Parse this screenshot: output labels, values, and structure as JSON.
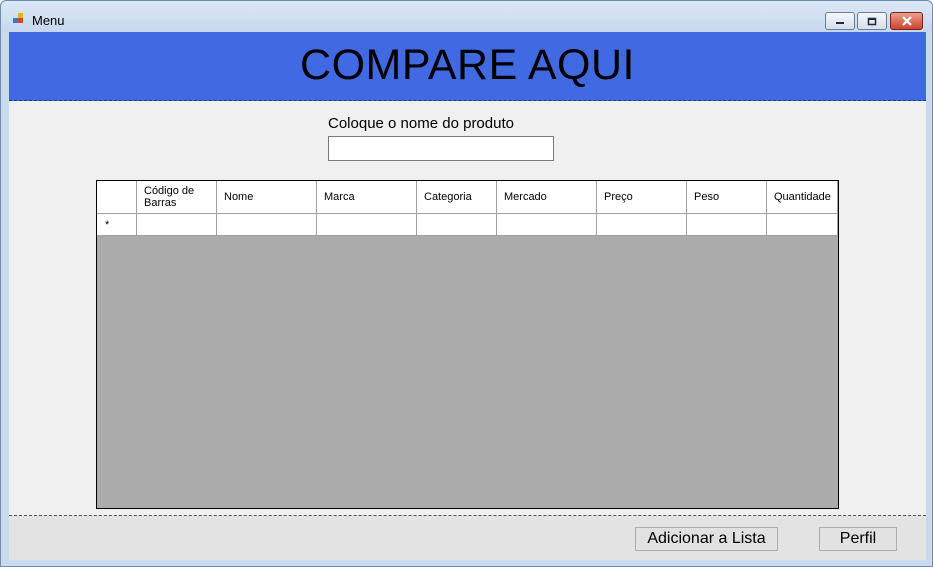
{
  "window": {
    "title": "Menu"
  },
  "banner": {
    "title": "COMPARE AQUI"
  },
  "search": {
    "label": "Coloque o nome do produto",
    "value": "",
    "placeholder": ""
  },
  "table": {
    "columns": [
      "Código de Barras",
      "Nome",
      "Marca",
      "Categoria",
      "Mercado",
      "Preço",
      "Peso",
      "Quantidade"
    ],
    "new_row_marker": "*"
  },
  "buttons": {
    "add_to_list": "Adicionar a Lista",
    "profile": "Perfil"
  },
  "colors": {
    "banner": "#4169e1",
    "grid_background": "#ababab",
    "form_background": "#f0f0f0"
  },
  "icons": {
    "app": "windows-form-icon",
    "minimize": "minimize-icon",
    "maximize": "maximize-icon",
    "close": "close-icon"
  }
}
